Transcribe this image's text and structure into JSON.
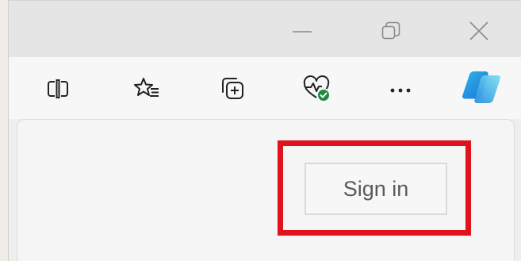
{
  "window": {
    "controls": [
      "minimize-icon",
      "restore-icon",
      "close-icon"
    ]
  },
  "toolbar": {
    "icons": [
      "split-screen-icon",
      "favorites-icon",
      "collections-icon",
      "browser-essentials-icon",
      "more-options-icon",
      "copilot-icon"
    ]
  },
  "account_panel": {
    "sign_in_label": "Sign in"
  },
  "colors": {
    "highlight": "#e0121b",
    "essentials_check": "#1f8a3c",
    "copilot_blue": "#1b6fd8",
    "copilot_cyan": "#2fb8e8"
  }
}
